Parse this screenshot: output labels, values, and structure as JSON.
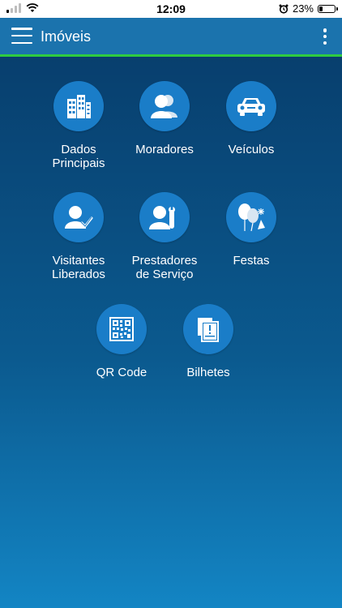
{
  "status_bar": {
    "time": "12:09",
    "battery_percent": "23%",
    "battery_level": 0.23
  },
  "app_bar": {
    "title": "Imóveis",
    "menu_icon": "hamburger-icon",
    "more_icon": "more-vert-icon"
  },
  "colors": {
    "app_bar": "#1b73ad",
    "accent_line": "#2ecc40",
    "icon_circle": "#1a7dc8"
  },
  "tiles": [
    {
      "label": "Dados\nPrincipais",
      "icon": "buildings-icon"
    },
    {
      "label": "Moradores",
      "icon": "people-icon"
    },
    {
      "label": "Veículos",
      "icon": "car-icon"
    },
    {
      "label": "Visitantes\nLiberados",
      "icon": "visitor-check-icon"
    },
    {
      "label": "Prestadores\nde Serviço",
      "icon": "service-provider-icon"
    },
    {
      "label": "Festas",
      "icon": "balloons-icon"
    },
    {
      "label": "QR Code",
      "icon": "qr-code-icon"
    },
    {
      "label": "Bilhetes",
      "icon": "notes-icon"
    }
  ]
}
